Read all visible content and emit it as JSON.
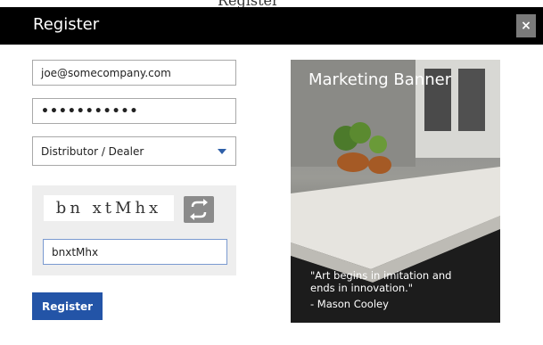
{
  "top_partial_text": "Register",
  "dialog": {
    "title": "Register",
    "close_label": "×"
  },
  "form": {
    "email_value": "joe@somecompany.com",
    "password_value": "•••••••••••",
    "role_value": "Distributor / Dealer"
  },
  "captcha": {
    "image_text": "bn xtMhx",
    "input_value": "bnxtMhx",
    "refresh_icon": "refresh-icon"
  },
  "register_button_label": "Register",
  "banner": {
    "title": "Marketing Banner",
    "quote": "\"Art begins in imitation and\nends in innovation.\"",
    "author": "- Mason Cooley"
  },
  "colors": {
    "title_bar": "#000000",
    "accent": "#2354a7",
    "close_button": "#7a7a7a"
  }
}
